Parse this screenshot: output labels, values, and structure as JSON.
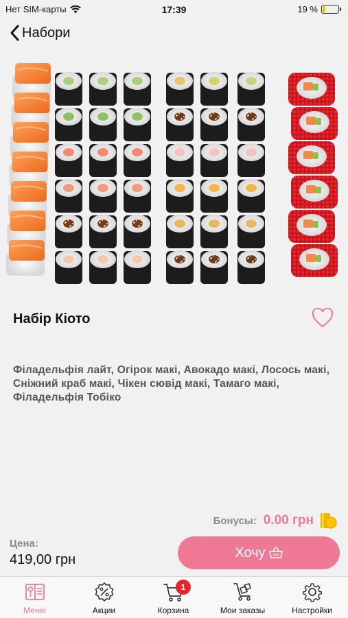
{
  "status_bar": {
    "carrier": "Нет SIM-карты",
    "time": "17:39",
    "battery_percent_text": "19 %",
    "battery_level": 0.19,
    "battery_color": "#f5c400"
  },
  "nav": {
    "back_label": "Набори",
    "back_icon": "chevron-left-icon"
  },
  "product": {
    "image_subject": "sushi-set-photo",
    "title": "Набір Кіото",
    "favorite_icon": "heart-outline-icon",
    "description": "Філадельфія лайт, Огірок макі, Авокадо макі, Лосось макі, Сніжний краб макі, Чікен сювід макі, Тамаго макі, Філадельфія Тобіко"
  },
  "bonus": {
    "label": "Бонусы:",
    "value": "0.00 грн",
    "icon": "coins-icon"
  },
  "price": {
    "label": "Цена:",
    "value": "419,00 грн"
  },
  "order_button": {
    "label": "Хочу",
    "icon": "basket-icon"
  },
  "colors": {
    "accent": "#ef7895",
    "badge": "#e5252a",
    "background": "#f1f1f2"
  },
  "tabbar": {
    "tabs": [
      {
        "label": "Меню",
        "icon": "menu-book-icon",
        "active": true
      },
      {
        "label": "Акции",
        "icon": "discount-icon",
        "active": false
      },
      {
        "label": "Корзина",
        "icon": "cart-icon",
        "active": false
      },
      {
        "label": "Мои заказы",
        "icon": "delivery-cart-icon",
        "active": false
      },
      {
        "label": "Настройки",
        "icon": "gear-icon",
        "active": false
      }
    ],
    "cart_badge": "1"
  }
}
